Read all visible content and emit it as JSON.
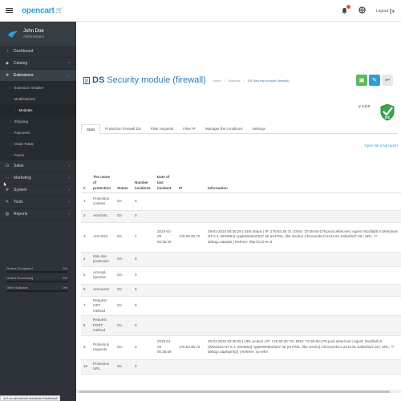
{
  "header": {
    "logo": "opencart",
    "logout": "Logout"
  },
  "profile": {
    "name": "John Doe",
    "role": "Administrator"
  },
  "sidebar": {
    "items": [
      {
        "label": "Dashboard",
        "icon": "dashboard-icon",
        "has_arrow": false
      },
      {
        "label": "Catalog",
        "icon": "tag-icon",
        "has_arrow": true
      },
      {
        "label": "Extensions",
        "icon": "puzzle-icon",
        "has_arrow": true,
        "active": true
      }
    ],
    "ext_sub": [
      {
        "label": "Extension Installer",
        "level": 1,
        "arrow": false
      },
      {
        "label": "Modifications",
        "level": 1,
        "arrow": false
      },
      {
        "label": "Modules",
        "level": 2,
        "arrow": false
      },
      {
        "label": "Shipping",
        "level": 1,
        "arrow": false
      },
      {
        "label": "Payments",
        "level": 1,
        "arrow": false
      },
      {
        "label": "Order Totals",
        "level": 1,
        "arrow": false
      },
      {
        "label": "Feeds",
        "level": 1,
        "arrow": false
      }
    ],
    "items_after": [
      {
        "label": "Sales",
        "icon": "cart-icon"
      },
      {
        "label": "Marketing",
        "icon": "share-icon"
      },
      {
        "label": "System",
        "icon": "cog-icon"
      },
      {
        "label": "Tools",
        "icon": "wrench-icon"
      },
      {
        "label": "Reports",
        "icon": "chart-icon"
      }
    ],
    "stats": [
      {
        "label": "Orders Completed",
        "value": "0%"
      },
      {
        "label": "Orders Processing",
        "value": "0%"
      },
      {
        "label": "Other Statuses",
        "value": "0%"
      }
    ]
  },
  "page": {
    "title_prefix": "DS",
    "title": "Security module (firewall)",
    "breadcrumb": [
      "Home",
      "Modules",
      "DS Security module (firewall)"
    ],
    "version": "v 1.2.0",
    "full_report": "Open file a full report"
  },
  "tabs": [
    "Stats",
    "Protection Firewall DS",
    "Filter requests",
    "Filter IP",
    "Manager the conditions",
    "Settings"
  ],
  "table": {
    "headers": [
      "#",
      "The name of protection",
      "Status",
      "Number incidents",
      "Date of last incident",
      "IP",
      "Information"
    ],
    "rows": [
      {
        "n": "1",
        "name": "Protection cookies",
        "status": "On",
        "num": "0",
        "date": "",
        "ip": "",
        "info": ""
      },
      {
        "n": "2",
        "name": "Anti-bots",
        "status": "On",
        "num": "0",
        "date": "",
        "ip": "",
        "info": ""
      },
      {
        "n": "3",
        "name": "Anti-XSS",
        "status": "On",
        "num": "1",
        "date": "2015-01-29 00:35:29",
        "ip": "178.93.35.72",
        "info": "29-01-2015 00:35:29 | XSS attack | IP: 178.93.35.72 | DNS: 72-35-93-178.pool.ukrtel.net | Agent: Mozilla/5.0 (Windows NT 6.1; WOW64) AppleWebKit/537.36 (KHTML, like Gecko) Chrome/40.0.2214.91 Safari/537.36 | URL: /?debug=1&aaas | Referer: http://oc2-en.d"
      },
      {
        "n": "4",
        "name": "Mini dos protection",
        "status": "On",
        "num": "0",
        "date": "",
        "ip": "",
        "info": ""
      },
      {
        "n": "5",
        "name": "Anti-sql-injection",
        "status": "On",
        "num": "0",
        "date": "",
        "ip": "",
        "info": ""
      },
      {
        "n": "6",
        "name": "Anti-worm",
        "status": "On",
        "num": "0",
        "date": "",
        "ip": "",
        "info": ""
      },
      {
        "n": "7",
        "name": "Request GET method",
        "status": "On",
        "num": "0",
        "date": "",
        "ip": "",
        "info": ""
      },
      {
        "n": "8",
        "name": "Request POST method",
        "status": "On",
        "num": "0",
        "date": "",
        "ip": "",
        "info": ""
      },
      {
        "n": "9",
        "name": "Protection requests",
        "status": "On",
        "num": "3",
        "date": "2015-01-29 00:36:08",
        "ip": "178.93.35.72",
        "info": "29-01-2015 00:36:08 | URL protect | IP: 178.93.35.72 | DNS: 72-35-93-178.pool.ukrtel.net | Agent: Mozilla/5.0 (Windows NT 6.1; WOW64) AppleWebKit/537.36 (KHTML, like Gecko) Chrome/40.0.2214.91 Safari/537.36 | URL: /?debug=1&phpinfo() | Referer: no refer"
      },
      {
        "n": "10",
        "name": "Protection URL",
        "status": "On",
        "num": "0",
        "date": "",
        "ip": "",
        "info": ""
      }
    ]
  },
  "status_url": "oc2-en.dev.webdh.net/admin/?dsfirewall"
}
